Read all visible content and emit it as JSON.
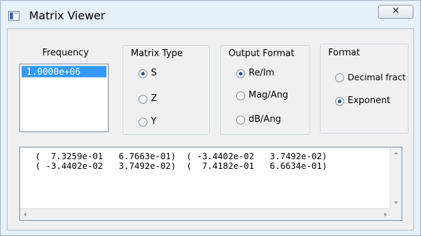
{
  "window": {
    "title": "Matrix Viewer",
    "close_glyph": "✕"
  },
  "frequency": {
    "label": "Frequency",
    "items": [
      "1.0000e+06"
    ],
    "selected_index": 0
  },
  "matrix_type": {
    "label": "Matrix Type",
    "options": [
      "S",
      "Z",
      "Y"
    ],
    "selected": "S"
  },
  "output_format": {
    "label": "Output Format",
    "options": [
      "Re/Im",
      "Mag/Ang",
      "dB/Ang"
    ],
    "selected": "Re/Im"
  },
  "format": {
    "label": "Format",
    "options": [
      "Decimal fract",
      "Exponent"
    ],
    "selected": "Exponent"
  },
  "output": {
    "lines": [
      "(  7.3259e-01   6.7663e-01)  ( -3.4402e-02   3.7492e-02)",
      "( -3.4402e-02   3.7492e-02)  (  7.4182e-01   6.6634e-01)"
    ]
  },
  "colors": {
    "selection": "#3399ff",
    "radio_dot": "#1b4f9b"
  }
}
